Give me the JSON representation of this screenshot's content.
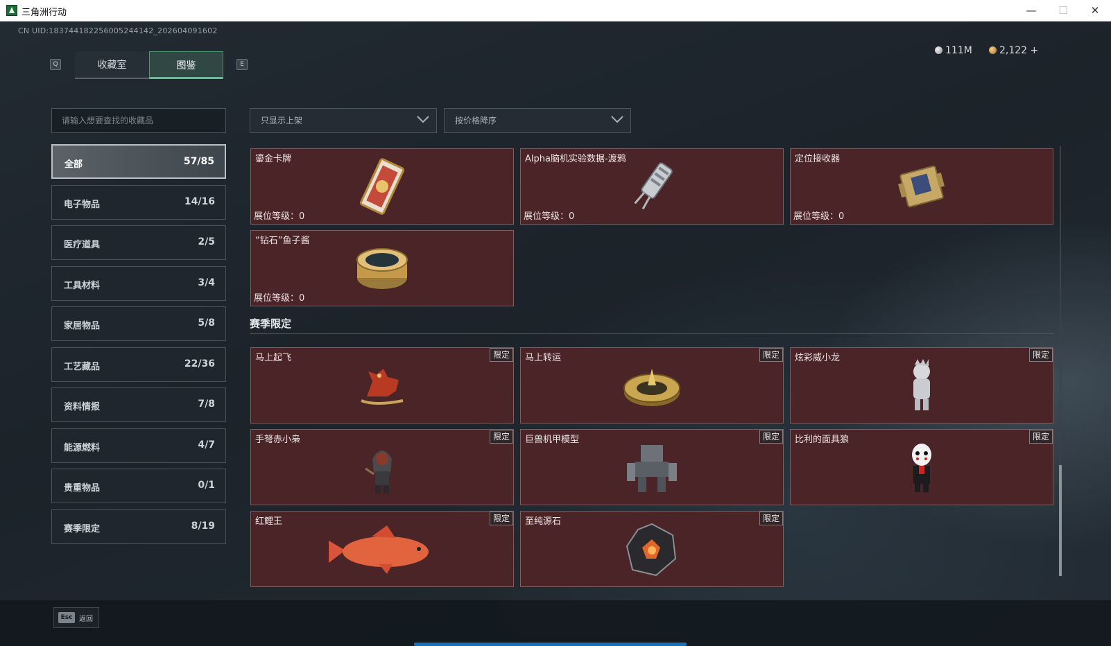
{
  "window": {
    "title": "三角洲行动",
    "minimize": "—",
    "maximize": "☐",
    "close": "✕"
  },
  "header": {
    "uid": "CN UID:183744182256005244142_202604091602",
    "key_prev": "Q",
    "key_next": "E",
    "tabs": [
      {
        "label": "收藏室",
        "active": false
      },
      {
        "label": "图鉴",
        "active": true
      }
    ],
    "currency_silver": "111M",
    "currency_gold": "2,122 +"
  },
  "sidebar": {
    "search_placeholder": "请输入想要查找的收藏品",
    "categories": [
      {
        "label": "全部",
        "count": "57/85",
        "active": true
      },
      {
        "label": "电子物品",
        "count": "14/16"
      },
      {
        "label": "医疗道具",
        "count": "2/5"
      },
      {
        "label": "工具材料",
        "count": "3/4"
      },
      {
        "label": "家居物品",
        "count": "5/8"
      },
      {
        "label": "工艺藏品",
        "count": "22/36"
      },
      {
        "label": "资料情报",
        "count": "7/8"
      },
      {
        "label": "能源燃料",
        "count": "4/7"
      },
      {
        "label": "贵重物品",
        "count": "0/1"
      },
      {
        "label": "赛季限定",
        "count": "8/19"
      }
    ]
  },
  "filters": {
    "shelf": "只显示上架",
    "sort": "按价格降序"
  },
  "collection": {
    "level_label": "展位等级：0",
    "items": [
      {
        "name": "鎏金卡牌"
      },
      {
        "name": "Alpha脑机实验数据-渡鸦"
      },
      {
        "name": "定位接收器"
      },
      {
        "name": "“钻石”鱼子酱"
      }
    ]
  },
  "season": {
    "title": "赛季限定",
    "badge": "限定",
    "items": [
      {
        "name": "马上起飞"
      },
      {
        "name": "马上转运"
      },
      {
        "name": "炫彩威小龙"
      },
      {
        "name": "手弩赤小枭"
      },
      {
        "name": "巨兽机甲模型"
      },
      {
        "name": "比利的面具狼"
      },
      {
        "name": "红鲤王"
      },
      {
        "name": "至纯源石"
      }
    ]
  },
  "footer": {
    "esc_key": "Esc",
    "esc_label": "返回"
  },
  "colors": {
    "card_bg": "#4a2427",
    "accent_green": "#57c497",
    "progress_blue": "#1a6fb6"
  }
}
